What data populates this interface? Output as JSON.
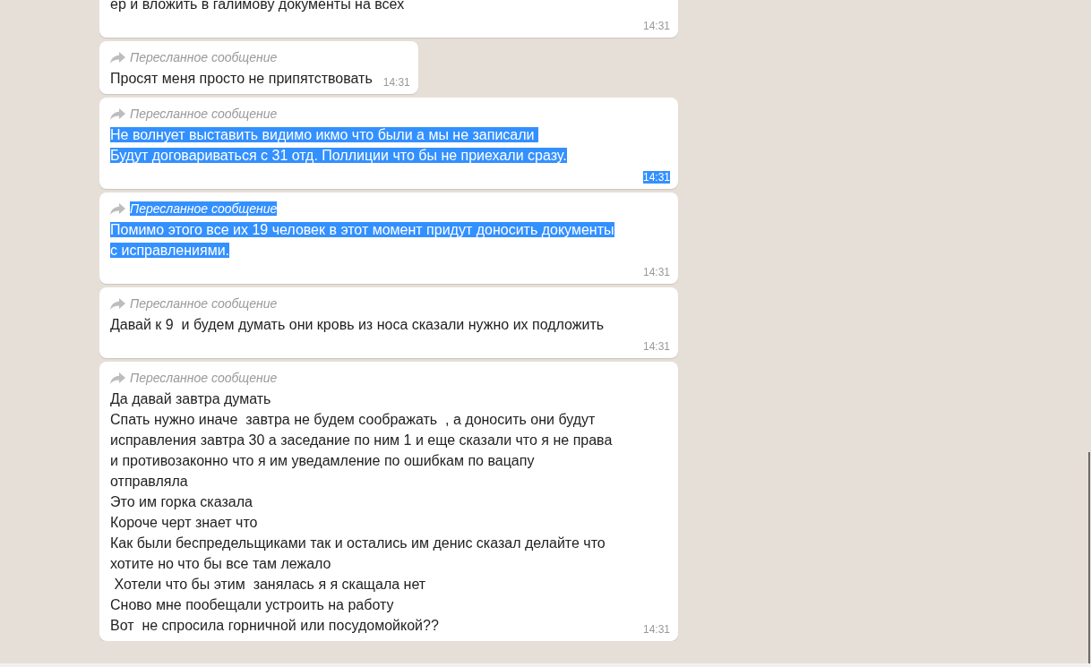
{
  "messages": [
    {
      "kind": "block-time",
      "forwarded": false,
      "lines": [
        "ер и вложить в галимову документы на всех"
      ],
      "time": "14:31",
      "body_selected": false,
      "time_selected": false
    },
    {
      "kind": "inline-time",
      "forwarded": true,
      "header": "Пересланное сообщение",
      "lines": [
        "Просят меня просто не припятствовать"
      ],
      "time": "14:31",
      "body_selected": false,
      "header_selected": false,
      "time_selected": false
    },
    {
      "kind": "block-time",
      "forwarded": true,
      "header": "Пересланное сообщение",
      "lines": [
        "Не волнует выставить видимо икмо что были а мы не записали ",
        "Будут договариваться с 31 отд. Поллиции что бы не приехали сразу."
      ],
      "time": "14:31",
      "body_selected": true,
      "header_selected": false,
      "time_selected": true
    },
    {
      "kind": "block-time",
      "forwarded": true,
      "header": "Пересланное сообщение",
      "lines": [
        "Помимо этого все их 19 человек в этот момент придут доносить документы",
        "с исправлениями."
      ],
      "time": "14:31",
      "body_selected": true,
      "header_selected": true,
      "time_selected": false
    },
    {
      "kind": "block-time",
      "forwarded": true,
      "header": "Пересланное сообщение",
      "lines": [
        "Давай к 9  и будем думать они кровь из носа сказали нужно их подложить"
      ],
      "time": "14:31",
      "body_selected": false,
      "header_selected": false,
      "time_selected": false
    },
    {
      "kind": "wide-inline-time",
      "forwarded": true,
      "header": "Пересланное сообщение",
      "lines": [
        "Да давай завтра думать",
        "Спать нужно иначе  завтра не будем соображать  , а доносить они будут",
        "исправления завтра 30 а заседание по ним 1 и еще сказали что я не права",
        "и противозаконно что я им уведамление по ошибкам по вацапу",
        "отправляла",
        "Это им горка сказала",
        "Короче черт знает что",
        "Как были беспредельщиками так и остались им денис сказал делайте что",
        "хотите но что бы все там лежало",
        " Хотели что бы этим  занялась я я скащала нет",
        "Сново мне пообещали устроить на работу",
        "Вот  не спросила горничной или посудомойкой??"
      ],
      "time": "14:31",
      "body_selected": false,
      "header_selected": false,
      "time_selected": false
    }
  ]
}
